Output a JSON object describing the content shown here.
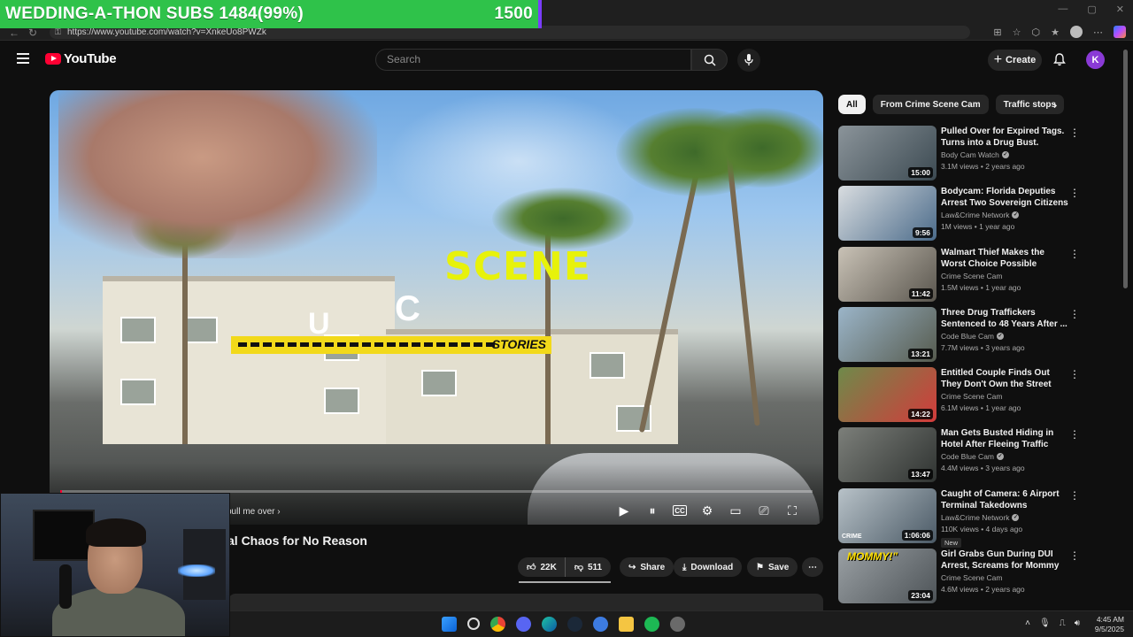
{
  "overlay": {
    "banner_left": "WEDDING-A-THON SUBS 1484(99%)",
    "banner_right": "1500"
  },
  "browser": {
    "url": "https://www.youtube.com/watch?v=XnkeUo8PWZk",
    "progress": 0.1
  },
  "masthead": {
    "logo_text": "YouTube",
    "search_placeholder": "Search",
    "create_label": "Create",
    "avatar_letter": "K"
  },
  "player": {
    "overlay_scene": "SCENE",
    "overlay_c": "C",
    "overlay_u": "U",
    "overlay_stripe": "STORIES",
    "pull_note": "pull me over",
    "progress_fraction": 0.002
  },
  "video": {
    "title": "al Chaos for No Reason",
    "likes": "22K",
    "dislikes": "511",
    "share_label": "Share",
    "download_label": "Download",
    "save_label": "Save"
  },
  "chips": [
    {
      "label": "All",
      "active": true
    },
    {
      "label": "From Crime Scene Cam",
      "active": false
    },
    {
      "label": "Traffic stops",
      "active": false
    }
  ],
  "recommendations": [
    {
      "title": "Pulled Over for Expired Tags. Turns into a Drug Bust.",
      "channel": "Body Cam Watch",
      "verified": true,
      "stats": "3.1M views • 2 years ago",
      "duration": "15:00",
      "thumb_tag": "",
      "badge": "",
      "thumb_colors": [
        "#8b949a",
        "#3c4a52"
      ]
    },
    {
      "title": "Bodycam: Florida Deputies Arrest Two Sovereign Citizens ...",
      "channel": "Law&Crime Network",
      "verified": true,
      "stats": "1M views • 1 year ago",
      "duration": "9:56",
      "thumb_tag": "",
      "badge": "",
      "thumb_colors": [
        "#d9dde0",
        "#4b6b8a"
      ]
    },
    {
      "title": "Walmart Thief Makes the Worst Choice Possible",
      "channel": "Crime Scene Cam",
      "verified": false,
      "stats": "1.5M views • 1 year ago",
      "duration": "11:42",
      "thumb_tag": "",
      "badge": "",
      "thumb_colors": [
        "#c9c2b6",
        "#5a564e"
      ]
    },
    {
      "title": "Three Drug Traffickers Sentenced to 48 Years After ...",
      "channel": "Code Blue Cam",
      "verified": true,
      "stats": "7.7M views • 3 years ago",
      "duration": "13:21",
      "thumb_tag": "",
      "badge": "",
      "thumb_colors": [
        "#9bb5c9",
        "#565b4e"
      ]
    },
    {
      "title": "Entitled Couple Finds Out They Don't Own the Street",
      "channel": "Crime Scene Cam",
      "verified": false,
      "stats": "6.1M views • 1 year ago",
      "duration": "14:22",
      "thumb_tag": "",
      "badge": "",
      "thumb_colors": [
        "#6e8a4a",
        "#d33b3b"
      ]
    },
    {
      "title": "Man Gets Busted Hiding in Hotel After Fleeing Traffic Stop",
      "channel": "Code Blue Cam",
      "verified": true,
      "stats": "4.4M views • 3 years ago",
      "duration": "13:47",
      "thumb_tag": "",
      "badge": "",
      "thumb_colors": [
        "#7c7f7a",
        "#2f3331"
      ]
    },
    {
      "title": "Caught of Camera: 6 Airport Terminal Takedowns",
      "channel": "Law&Crime Network",
      "verified": true,
      "stats": "110K views • 4 days ago",
      "duration": "1:06:06",
      "thumb_tag": "CRIME",
      "badge": "New",
      "thumb_colors": [
        "#b8c2c8",
        "#4b5a66"
      ]
    },
    {
      "title": "Girl Grabs Gun During DUI Arrest, Screams for Mommy",
      "channel": "Crime Scene Cam",
      "verified": false,
      "stats": "4.6M views • 2 years ago",
      "duration": "23:04",
      "thumb_tag": "MOMMY!\"",
      "badge": "",
      "thumb_colors": [
        "#9aa0a4",
        "#4d5357"
      ]
    }
  ],
  "taskbar": {
    "time": "4:45 AM",
    "date": "9/5/2025"
  }
}
